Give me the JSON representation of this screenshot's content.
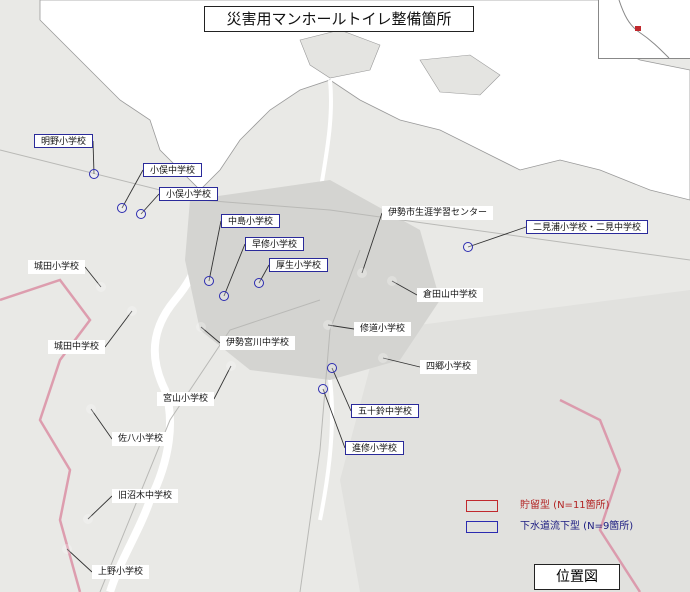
{
  "title": "災害用マンホールトイレ整備箇所",
  "location_label": "位置図",
  "legend": {
    "storage": "貯留型 (N=11箇所)",
    "sewer": "下水道流下型 (N=9箇所)"
  },
  "colors": {
    "storage": "#c0282d",
    "sewer": "#2b2bb0",
    "water": "#ffffff",
    "land": "#e9e9e6"
  },
  "sites": [
    {
      "name": "明野小学校",
      "type": "sewer"
    },
    {
      "name": "小俣中学校",
      "type": "sewer"
    },
    {
      "name": "小俣小学校",
      "type": "sewer"
    },
    {
      "name": "中島小学校",
      "type": "sewer"
    },
    {
      "name": "早修小学校",
      "type": "sewer"
    },
    {
      "name": "厚生小学校",
      "type": "sewer"
    },
    {
      "name": "伊勢市生涯学習センター",
      "type": "storage"
    },
    {
      "name": "二見浦小学校・二見中学校",
      "type": "sewer"
    },
    {
      "name": "城田小学校",
      "type": "storage"
    },
    {
      "name": "倉田山中学校",
      "type": "storage"
    },
    {
      "name": "城田中学校",
      "type": "storage"
    },
    {
      "name": "伊勢宮川中学校",
      "type": "storage"
    },
    {
      "name": "修道小学校",
      "type": "storage"
    },
    {
      "name": "四郷小学校",
      "type": "storage"
    },
    {
      "name": "宮山小学校",
      "type": "storage"
    },
    {
      "name": "五十鈴中学校",
      "type": "sewer"
    },
    {
      "name": "佐八小学校",
      "type": "storage"
    },
    {
      "name": "進修小学校",
      "type": "sewer"
    },
    {
      "name": "旧沼木中学校",
      "type": "storage"
    },
    {
      "name": "上野小学校",
      "type": "storage"
    }
  ]
}
